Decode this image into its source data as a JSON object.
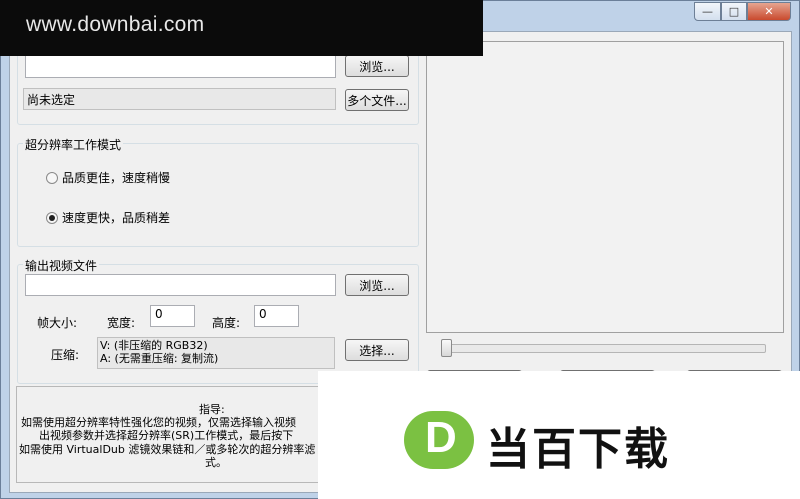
{
  "watermark": {
    "text": "www.downbai.com"
  },
  "title_bar": {
    "minimize": "—",
    "maximize": "□",
    "close": "✕"
  },
  "input_section": {
    "input_value": "",
    "browse_label": "浏览...",
    "status_text": "尚未选定",
    "multi_files_label": "多个文件..."
  },
  "mode_group": {
    "title": "超分辨率工作模式",
    "options": [
      {
        "label": "品质更佳，速度稍慢",
        "selected": false
      },
      {
        "label": "速度更快，品质稍差",
        "selected": true
      }
    ]
  },
  "output_group": {
    "title": "输出视频文件",
    "file_value": "",
    "browse_label": "浏览...",
    "frame_size_label": "帧大小:",
    "width_label": "宽度:",
    "width_value": "0",
    "height_label": "高度:",
    "height_value": "0",
    "compress_label": "压缩:",
    "compress_lines": [
      "V: (非压缩的 RGB32)",
      "A: (无需重压缩: 复制流)"
    ],
    "select_label": "选择..."
  },
  "guide": {
    "title": "指导:",
    "lines": [
      "如需使用超分辨率特性强化您的视频，仅需选择输入视频",
      "出视频参数并选择超分辨率(SR)工作模式，最后按下",
      "如需使用 VirtualDub 滤镜效果链和／或多轮次的超分辨率滤",
      "式。"
    ]
  },
  "slider": {
    "position": 0
  },
  "overlay_logo": {
    "letter": "D",
    "text": "当百下载",
    "circle_color": "#7bc142"
  }
}
